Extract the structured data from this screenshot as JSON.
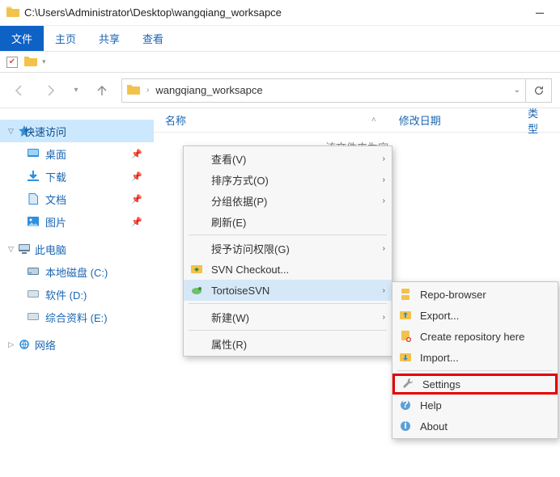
{
  "title": {
    "path": "C:\\Users\\Administrator\\Desktop\\wangqiang_worksapce"
  },
  "menubar": {
    "file": "文件",
    "home": "主页",
    "share": "共享",
    "view": "查看"
  },
  "address": {
    "crumb": "wangqiang_worksapce"
  },
  "sidebar": {
    "quick_access": "快速访问",
    "items": [
      {
        "label": "桌面"
      },
      {
        "label": "下载"
      },
      {
        "label": "文档"
      },
      {
        "label": "图片"
      }
    ],
    "this_pc": "此电脑",
    "drives": [
      {
        "label": "本地磁盘 (C:)"
      },
      {
        "label": "软件 (D:)"
      },
      {
        "label": "综合资料 (E:)"
      }
    ],
    "network": "网络"
  },
  "columns": {
    "name": "名称",
    "date": "修改日期",
    "type": "类型"
  },
  "empty_text": "该文件夹为空",
  "ctx1": {
    "view": "查看(V)",
    "sort": "排序方式(O)",
    "group": "分组依据(P)",
    "refresh": "刷新(E)",
    "grant": "授予访问权限(G)",
    "svn_checkout": "SVN Checkout...",
    "tortoisesvn": "TortoiseSVN",
    "new": "新建(W)",
    "props": "属性(R)"
  },
  "ctx2": {
    "repo_browser": "Repo-browser",
    "export": "Export...",
    "create_repo": "Create repository here",
    "import": "Import...",
    "settings": "Settings",
    "help": "Help",
    "about": "About"
  }
}
